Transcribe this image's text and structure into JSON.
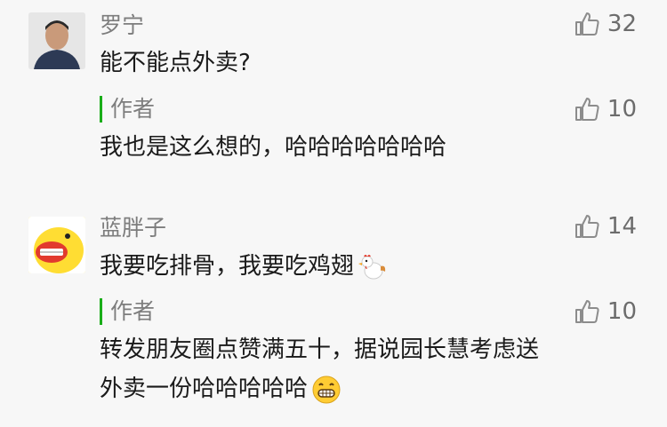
{
  "comments": [
    {
      "nickname": "罗宁",
      "text": "能不能点外卖?",
      "likes": "32",
      "reply": {
        "author_label": "作者",
        "text": "我也是这么想的，哈哈哈哈哈哈哈",
        "likes": "10"
      }
    },
    {
      "nickname": "蓝胖子",
      "text": "我要吃排骨，我要吃鸡翅",
      "text_emoji": "rooster-emoji",
      "likes": "14",
      "reply": {
        "author_label": "作者",
        "text_line1": "转发朋友圈点赞满五十，据说园长慧考虑送",
        "text_line2": "外卖一份哈哈哈哈哈",
        "text_emoji": "grinning-emoji",
        "likes": "10"
      }
    }
  ],
  "colors": {
    "background": "#f7f7f7",
    "author_accent": "#1aad19",
    "nickname": "#7d7d7d",
    "text": "#1a1a1a"
  }
}
